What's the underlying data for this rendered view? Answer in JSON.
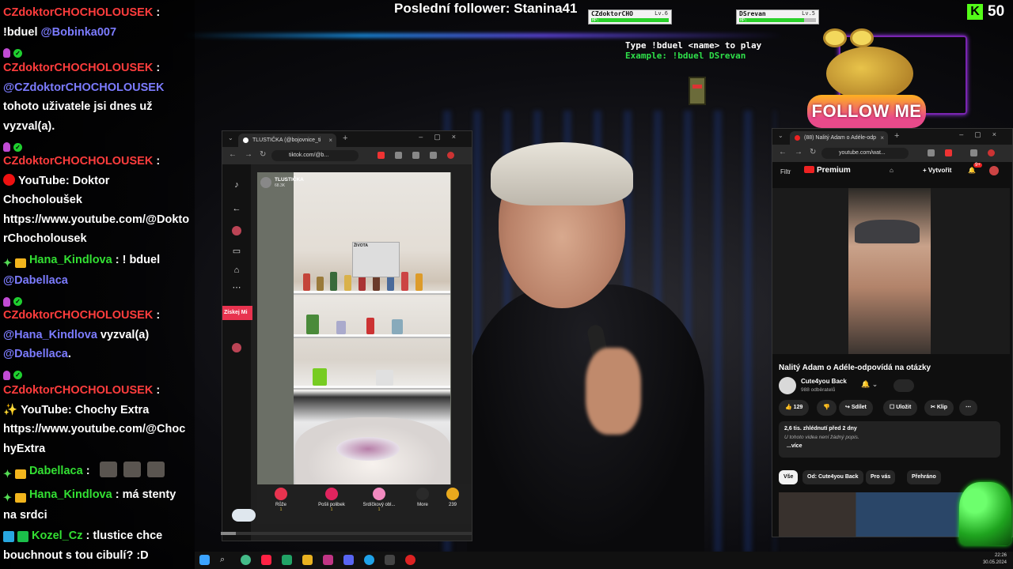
{
  "overlay": {
    "last_follower": "Poslední follower: Stanina41",
    "duel_hint_line1": "Type !bduel <name> to play",
    "duel_hint_line2": "Example: !bduel DSrevan",
    "follow_button": "FOLLOW ME",
    "kick_count": "50",
    "kick_logo": "K",
    "player1": {
      "name": "CZdoktorCHO",
      "level": "Lv.6",
      "hp_label": "HP:",
      "hp_fraction": 1.0
    },
    "player2": {
      "name": "DSrevan",
      "level": "Lv.5",
      "hp_label": "HP:",
      "hp_fraction": 0.85
    }
  },
  "chat": {
    "messages": [
      {
        "user": "CZdoktorCHOCHOLOUSEK",
        "text": "!bduel",
        "mention": "@Bobinka007"
      },
      {
        "user": "CZdoktorCHOCHOLOUSEK",
        "mention": "@CZdoktorCHOCHOLOUSEK",
        "text": "tohoto uživatele jsi dnes už vyzval(a)."
      },
      {
        "user": "CZdoktorCHOCHOLOUSEK",
        "prefix": "YouTube: Doktor Chocholoušek",
        "text": "https://www.youtube.com/@DoktorChocholousek"
      },
      {
        "user": "Hana_Kindlova",
        "text": "! bduel",
        "mention": "@Dabellaca"
      },
      {
        "user": "CZdoktorCHOCHOLOUSEK",
        "mention": "@Hana_Kindlova",
        "text": "vyzval(a)",
        "mention2": "@Dabellaca",
        "tail": "."
      },
      {
        "user": "CZdoktorCHOCHOLOUSEK",
        "prefix": "YouTube: Chochy Extra",
        "text": "https://www.youtube.com/@ChochyExtra"
      },
      {
        "user": "Dabellaca",
        "text": ""
      },
      {
        "user": "Hana_Kindlova",
        "text": "má stenty na srdci"
      },
      {
        "user": "Kozel_Cz",
        "text": "tlustice chce bouchnout s tou cibulí? :D"
      }
    ],
    "separator": ":"
  },
  "tiktok": {
    "tab_title": "TLUSTIČKA (@bojovnice_ti",
    "url": "tiktok.com/@b...",
    "get_app": "Získej Mi",
    "live_name": "TLUSTIČKA",
    "live_sub": "68.3K",
    "poster_text": "ŽIVOTA",
    "gifts": [
      {
        "label": "Růže",
        "coins": "1",
        "color": "#e8334f"
      },
      {
        "label": "Pošli polibek",
        "coins": "1",
        "color": "#e0245e"
      },
      {
        "label": "Srdíčkový obl...",
        "coins": "1",
        "color": "#f28ac0"
      },
      {
        "label": "More",
        "coins": "",
        "color": "#2a2a2a"
      },
      {
        "label": "239",
        "coins": "",
        "color": "#e9a91d"
      }
    ],
    "progress_fraction": 0.06
  },
  "youtube": {
    "tab_title": "(88) Nalitý Adam o Adéle-odp",
    "url": "youtube.com/wat...",
    "filter_label": "Filtr",
    "premium_label": "Premium",
    "create_label": "Vytvořit",
    "notif_count": "9+",
    "video_title": "Nalitý Adam o Adéle-odpovídá na otázky",
    "channel": "Cute4you Back",
    "subs": "988 odběratelů",
    "likes": "129",
    "share": "Sdílet",
    "save": "Uložit",
    "clip": "Klip",
    "views_date": "2,6 tis. zhlédnutí  před 2 dny",
    "no_desc": "U tohoto videa není žádný popis.",
    "more": "...více",
    "chips": [
      "Vše",
      "Od: Cute4you Back",
      "Pro vás",
      "Přehráno"
    ]
  },
  "taskbar": {
    "time": "22:26",
    "date": "30.05.2024"
  }
}
